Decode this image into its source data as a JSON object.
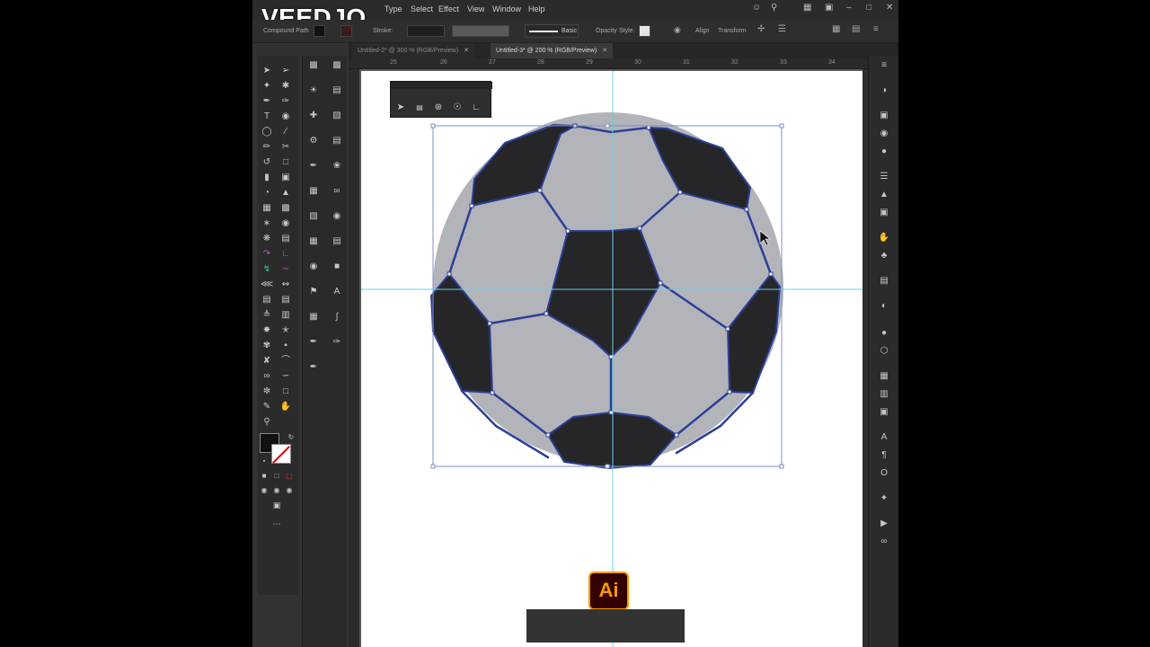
{
  "watermark": "VEEDJO",
  "menu": [
    "Type",
    "Select",
    "Effect",
    "View",
    "Window",
    "Help"
  ],
  "control_bar": {
    "selection_label": "Compound Path",
    "stroke_label": "Stroke:",
    "brush_style": "Basic",
    "opacity_label": "Opacity",
    "style_label": "Style:",
    "align_label": "Align",
    "transform_label": "Transform"
  },
  "tabs": [
    {
      "label": "Untitled-2* @ 300 % (RGB/Preview)",
      "active": false
    },
    {
      "label": "Untitled-3* @ 200 % (RGB/Preview)",
      "active": true
    }
  ],
  "ruler_marks": [
    "25",
    "26",
    "27",
    "28",
    "29",
    "30",
    "31",
    "32",
    "33",
    "34"
  ],
  "app_badge": "Ai",
  "colors": {
    "ball_base": "#b3b4b9",
    "panel_dark": "#262628",
    "path_blue": "#2c3f99",
    "guide_cyan": "#66d0e8",
    "artboard": "#ffffff",
    "ai_orange": "#ff9a00"
  }
}
